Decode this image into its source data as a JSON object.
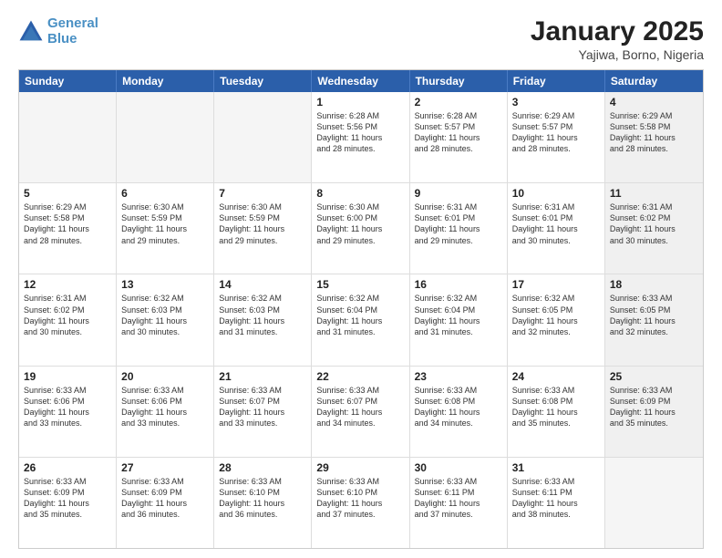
{
  "logo": {
    "line1": "General",
    "line2": "Blue"
  },
  "title": "January 2025",
  "subtitle": "Yajiwa, Borno, Nigeria",
  "days_of_week": [
    "Sunday",
    "Monday",
    "Tuesday",
    "Wednesday",
    "Thursday",
    "Friday",
    "Saturday"
  ],
  "weeks": [
    [
      {
        "num": "",
        "info": "",
        "empty": true
      },
      {
        "num": "",
        "info": "",
        "empty": true
      },
      {
        "num": "",
        "info": "",
        "empty": true
      },
      {
        "num": "1",
        "info": "Sunrise: 6:28 AM\nSunset: 5:56 PM\nDaylight: 11 hours\nand 28 minutes.",
        "empty": false
      },
      {
        "num": "2",
        "info": "Sunrise: 6:28 AM\nSunset: 5:57 PM\nDaylight: 11 hours\nand 28 minutes.",
        "empty": false
      },
      {
        "num": "3",
        "info": "Sunrise: 6:29 AM\nSunset: 5:57 PM\nDaylight: 11 hours\nand 28 minutes.",
        "empty": false
      },
      {
        "num": "4",
        "info": "Sunrise: 6:29 AM\nSunset: 5:58 PM\nDaylight: 11 hours\nand 28 minutes.",
        "empty": false,
        "shaded": true
      }
    ],
    [
      {
        "num": "5",
        "info": "Sunrise: 6:29 AM\nSunset: 5:58 PM\nDaylight: 11 hours\nand 28 minutes.",
        "empty": false
      },
      {
        "num": "6",
        "info": "Sunrise: 6:30 AM\nSunset: 5:59 PM\nDaylight: 11 hours\nand 29 minutes.",
        "empty": false
      },
      {
        "num": "7",
        "info": "Sunrise: 6:30 AM\nSunset: 5:59 PM\nDaylight: 11 hours\nand 29 minutes.",
        "empty": false
      },
      {
        "num": "8",
        "info": "Sunrise: 6:30 AM\nSunset: 6:00 PM\nDaylight: 11 hours\nand 29 minutes.",
        "empty": false
      },
      {
        "num": "9",
        "info": "Sunrise: 6:31 AM\nSunset: 6:01 PM\nDaylight: 11 hours\nand 29 minutes.",
        "empty": false
      },
      {
        "num": "10",
        "info": "Sunrise: 6:31 AM\nSunset: 6:01 PM\nDaylight: 11 hours\nand 30 minutes.",
        "empty": false
      },
      {
        "num": "11",
        "info": "Sunrise: 6:31 AM\nSunset: 6:02 PM\nDaylight: 11 hours\nand 30 minutes.",
        "empty": false,
        "shaded": true
      }
    ],
    [
      {
        "num": "12",
        "info": "Sunrise: 6:31 AM\nSunset: 6:02 PM\nDaylight: 11 hours\nand 30 minutes.",
        "empty": false
      },
      {
        "num": "13",
        "info": "Sunrise: 6:32 AM\nSunset: 6:03 PM\nDaylight: 11 hours\nand 30 minutes.",
        "empty": false
      },
      {
        "num": "14",
        "info": "Sunrise: 6:32 AM\nSunset: 6:03 PM\nDaylight: 11 hours\nand 31 minutes.",
        "empty": false
      },
      {
        "num": "15",
        "info": "Sunrise: 6:32 AM\nSunset: 6:04 PM\nDaylight: 11 hours\nand 31 minutes.",
        "empty": false
      },
      {
        "num": "16",
        "info": "Sunrise: 6:32 AM\nSunset: 6:04 PM\nDaylight: 11 hours\nand 31 minutes.",
        "empty": false
      },
      {
        "num": "17",
        "info": "Sunrise: 6:32 AM\nSunset: 6:05 PM\nDaylight: 11 hours\nand 32 minutes.",
        "empty": false
      },
      {
        "num": "18",
        "info": "Sunrise: 6:33 AM\nSunset: 6:05 PM\nDaylight: 11 hours\nand 32 minutes.",
        "empty": false,
        "shaded": true
      }
    ],
    [
      {
        "num": "19",
        "info": "Sunrise: 6:33 AM\nSunset: 6:06 PM\nDaylight: 11 hours\nand 33 minutes.",
        "empty": false
      },
      {
        "num": "20",
        "info": "Sunrise: 6:33 AM\nSunset: 6:06 PM\nDaylight: 11 hours\nand 33 minutes.",
        "empty": false
      },
      {
        "num": "21",
        "info": "Sunrise: 6:33 AM\nSunset: 6:07 PM\nDaylight: 11 hours\nand 33 minutes.",
        "empty": false
      },
      {
        "num": "22",
        "info": "Sunrise: 6:33 AM\nSunset: 6:07 PM\nDaylight: 11 hours\nand 34 minutes.",
        "empty": false
      },
      {
        "num": "23",
        "info": "Sunrise: 6:33 AM\nSunset: 6:08 PM\nDaylight: 11 hours\nand 34 minutes.",
        "empty": false
      },
      {
        "num": "24",
        "info": "Sunrise: 6:33 AM\nSunset: 6:08 PM\nDaylight: 11 hours\nand 35 minutes.",
        "empty": false
      },
      {
        "num": "25",
        "info": "Sunrise: 6:33 AM\nSunset: 6:09 PM\nDaylight: 11 hours\nand 35 minutes.",
        "empty": false,
        "shaded": true
      }
    ],
    [
      {
        "num": "26",
        "info": "Sunrise: 6:33 AM\nSunset: 6:09 PM\nDaylight: 11 hours\nand 35 minutes.",
        "empty": false
      },
      {
        "num": "27",
        "info": "Sunrise: 6:33 AM\nSunset: 6:09 PM\nDaylight: 11 hours\nand 36 minutes.",
        "empty": false
      },
      {
        "num": "28",
        "info": "Sunrise: 6:33 AM\nSunset: 6:10 PM\nDaylight: 11 hours\nand 36 minutes.",
        "empty": false
      },
      {
        "num": "29",
        "info": "Sunrise: 6:33 AM\nSunset: 6:10 PM\nDaylight: 11 hours\nand 37 minutes.",
        "empty": false
      },
      {
        "num": "30",
        "info": "Sunrise: 6:33 AM\nSunset: 6:11 PM\nDaylight: 11 hours\nand 37 minutes.",
        "empty": false
      },
      {
        "num": "31",
        "info": "Sunrise: 6:33 AM\nSunset: 6:11 PM\nDaylight: 11 hours\nand 38 minutes.",
        "empty": false
      },
      {
        "num": "",
        "info": "",
        "empty": true,
        "shaded": true
      }
    ]
  ]
}
